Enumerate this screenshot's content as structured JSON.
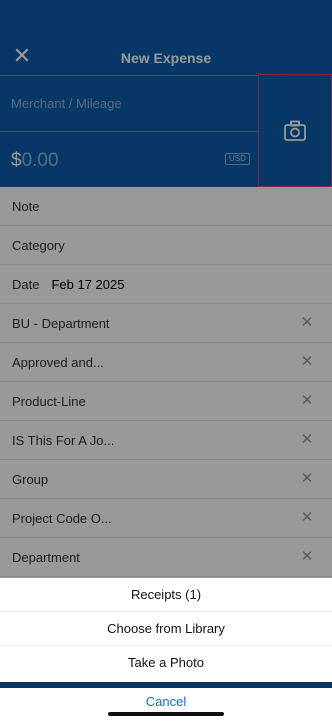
{
  "header": {
    "close_icon": "close-icon",
    "title": "New Expense",
    "merchant_placeholder": "Merchant / Mileage",
    "currency_symbol": "$",
    "amount_value": "0.00",
    "currency_code": "USD",
    "camera_icon": "camera-icon",
    "colors": {
      "header_bg": "#0b5cab",
      "highlight_border": "#e0457b"
    }
  },
  "fields": [
    {
      "label": "Note"
    },
    {
      "label": "Category"
    },
    {
      "label": "Date",
      "value": "Feb 17 2025"
    },
    {
      "label": "BU - Department",
      "clear_icon": "clear-icon"
    },
    {
      "label": "Approved and...",
      "clear_icon": "clear-icon"
    },
    {
      "label": "Product-Line",
      "clear_icon": "clear-icon"
    },
    {
      "label": "IS This For A Jo...",
      "clear_icon": "clear-icon"
    },
    {
      "label": "Group",
      "clear_icon": "clear-icon"
    },
    {
      "label": "Project Code O...",
      "clear_icon": "clear-icon"
    },
    {
      "label": "Department",
      "clear_icon": "clear-icon"
    }
  ],
  "action_sheet": {
    "items": [
      "Receipts (1)",
      "Choose from Library",
      "Take a Photo"
    ],
    "cancel_label": "Cancel",
    "cancel_color": "#0b6fd6"
  }
}
